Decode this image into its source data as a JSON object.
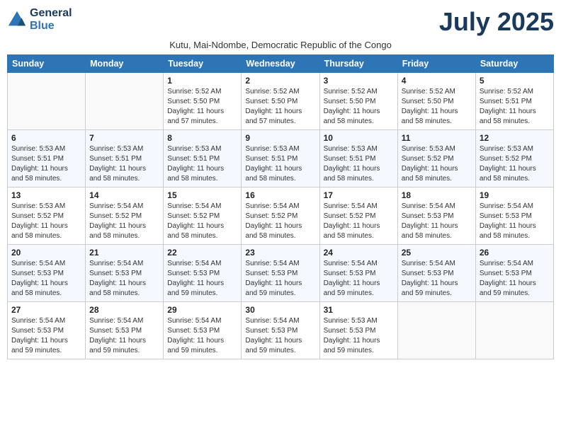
{
  "header": {
    "logo_line1": "General",
    "logo_line2": "Blue",
    "month_title": "July 2025",
    "subtitle": "Kutu, Mai-Ndombe, Democratic Republic of the Congo"
  },
  "days_of_week": [
    "Sunday",
    "Monday",
    "Tuesday",
    "Wednesday",
    "Thursday",
    "Friday",
    "Saturday"
  ],
  "weeks": [
    [
      {
        "day": "",
        "info": ""
      },
      {
        "day": "",
        "info": ""
      },
      {
        "day": "1",
        "info": "Sunrise: 5:52 AM\nSunset: 5:50 PM\nDaylight: 11 hours and 57 minutes."
      },
      {
        "day": "2",
        "info": "Sunrise: 5:52 AM\nSunset: 5:50 PM\nDaylight: 11 hours and 57 minutes."
      },
      {
        "day": "3",
        "info": "Sunrise: 5:52 AM\nSunset: 5:50 PM\nDaylight: 11 hours and 58 minutes."
      },
      {
        "day": "4",
        "info": "Sunrise: 5:52 AM\nSunset: 5:50 PM\nDaylight: 11 hours and 58 minutes."
      },
      {
        "day": "5",
        "info": "Sunrise: 5:52 AM\nSunset: 5:51 PM\nDaylight: 11 hours and 58 minutes."
      }
    ],
    [
      {
        "day": "6",
        "info": "Sunrise: 5:53 AM\nSunset: 5:51 PM\nDaylight: 11 hours and 58 minutes."
      },
      {
        "day": "7",
        "info": "Sunrise: 5:53 AM\nSunset: 5:51 PM\nDaylight: 11 hours and 58 minutes."
      },
      {
        "day": "8",
        "info": "Sunrise: 5:53 AM\nSunset: 5:51 PM\nDaylight: 11 hours and 58 minutes."
      },
      {
        "day": "9",
        "info": "Sunrise: 5:53 AM\nSunset: 5:51 PM\nDaylight: 11 hours and 58 minutes."
      },
      {
        "day": "10",
        "info": "Sunrise: 5:53 AM\nSunset: 5:51 PM\nDaylight: 11 hours and 58 minutes."
      },
      {
        "day": "11",
        "info": "Sunrise: 5:53 AM\nSunset: 5:52 PM\nDaylight: 11 hours and 58 minutes."
      },
      {
        "day": "12",
        "info": "Sunrise: 5:53 AM\nSunset: 5:52 PM\nDaylight: 11 hours and 58 minutes."
      }
    ],
    [
      {
        "day": "13",
        "info": "Sunrise: 5:53 AM\nSunset: 5:52 PM\nDaylight: 11 hours and 58 minutes."
      },
      {
        "day": "14",
        "info": "Sunrise: 5:54 AM\nSunset: 5:52 PM\nDaylight: 11 hours and 58 minutes."
      },
      {
        "day": "15",
        "info": "Sunrise: 5:54 AM\nSunset: 5:52 PM\nDaylight: 11 hours and 58 minutes."
      },
      {
        "day": "16",
        "info": "Sunrise: 5:54 AM\nSunset: 5:52 PM\nDaylight: 11 hours and 58 minutes."
      },
      {
        "day": "17",
        "info": "Sunrise: 5:54 AM\nSunset: 5:52 PM\nDaylight: 11 hours and 58 minutes."
      },
      {
        "day": "18",
        "info": "Sunrise: 5:54 AM\nSunset: 5:53 PM\nDaylight: 11 hours and 58 minutes."
      },
      {
        "day": "19",
        "info": "Sunrise: 5:54 AM\nSunset: 5:53 PM\nDaylight: 11 hours and 58 minutes."
      }
    ],
    [
      {
        "day": "20",
        "info": "Sunrise: 5:54 AM\nSunset: 5:53 PM\nDaylight: 11 hours and 58 minutes."
      },
      {
        "day": "21",
        "info": "Sunrise: 5:54 AM\nSunset: 5:53 PM\nDaylight: 11 hours and 58 minutes."
      },
      {
        "day": "22",
        "info": "Sunrise: 5:54 AM\nSunset: 5:53 PM\nDaylight: 11 hours and 59 minutes."
      },
      {
        "day": "23",
        "info": "Sunrise: 5:54 AM\nSunset: 5:53 PM\nDaylight: 11 hours and 59 minutes."
      },
      {
        "day": "24",
        "info": "Sunrise: 5:54 AM\nSunset: 5:53 PM\nDaylight: 11 hours and 59 minutes."
      },
      {
        "day": "25",
        "info": "Sunrise: 5:54 AM\nSunset: 5:53 PM\nDaylight: 11 hours and 59 minutes."
      },
      {
        "day": "26",
        "info": "Sunrise: 5:54 AM\nSunset: 5:53 PM\nDaylight: 11 hours and 59 minutes."
      }
    ],
    [
      {
        "day": "27",
        "info": "Sunrise: 5:54 AM\nSunset: 5:53 PM\nDaylight: 11 hours and 59 minutes."
      },
      {
        "day": "28",
        "info": "Sunrise: 5:54 AM\nSunset: 5:53 PM\nDaylight: 11 hours and 59 minutes."
      },
      {
        "day": "29",
        "info": "Sunrise: 5:54 AM\nSunset: 5:53 PM\nDaylight: 11 hours and 59 minutes."
      },
      {
        "day": "30",
        "info": "Sunrise: 5:54 AM\nSunset: 5:53 PM\nDaylight: 11 hours and 59 minutes."
      },
      {
        "day": "31",
        "info": "Sunrise: 5:53 AM\nSunset: 5:53 PM\nDaylight: 11 hours and 59 minutes."
      },
      {
        "day": "",
        "info": ""
      },
      {
        "day": "",
        "info": ""
      }
    ]
  ]
}
